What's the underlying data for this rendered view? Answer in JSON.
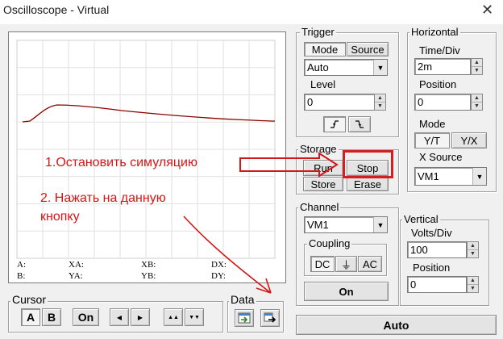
{
  "window": {
    "title": "Oscilloscope - Virtual",
    "close_glyph": "✕"
  },
  "scope": {
    "readouts": {
      "a": "A:",
      "xa": "XA:",
      "xb": "XB:",
      "dx": "DX:",
      "b": "B:",
      "ya": "YA:",
      "yb": "YB:",
      "dy": "DY:"
    },
    "trace_color": "#8b0000"
  },
  "trigger": {
    "title": "Trigger",
    "mode_label": "Mode",
    "source_label": "Source",
    "mode_value": "Auto",
    "level_label": "Level",
    "level_value": "0",
    "rise_icon": "rising-edge-icon",
    "fall_icon": "falling-edge-icon"
  },
  "horizontal": {
    "title": "Horizontal",
    "time_div_label": "Time/Div",
    "time_div_value": "2m",
    "position_label": "Position",
    "position_value": "0",
    "mode_label": "Mode",
    "yt_label": "Y/T",
    "yx_label": "Y/X",
    "x_source_label": "X Source",
    "x_source_value": "VM1"
  },
  "storage": {
    "title": "Storage",
    "run_label": "Run",
    "stop_label": "Stop",
    "store_label": "Store",
    "erase_label": "Erase"
  },
  "channel": {
    "title": "Channel",
    "value": "VM1",
    "coupling_title": "Coupling",
    "dc_label": "DC",
    "gnd_glyph": "⏚",
    "ac_label": "AC",
    "on_label": "On"
  },
  "vertical": {
    "title": "Vertical",
    "volts_div_label": "Volts/Div",
    "volts_div_value": "100",
    "position_label": "Position",
    "position_value": "0"
  },
  "cursor": {
    "title": "Cursor",
    "a_label": "A",
    "b_label": "B",
    "on_label": "On"
  },
  "data_group": {
    "title": "Data"
  },
  "auto_label": "Auto",
  "annotations": {
    "step1": "1.Остановить симуляцию",
    "step2_line1": "2. Нажать на данную",
    "step2_line2": "кнопку",
    "color": "#d41616"
  }
}
